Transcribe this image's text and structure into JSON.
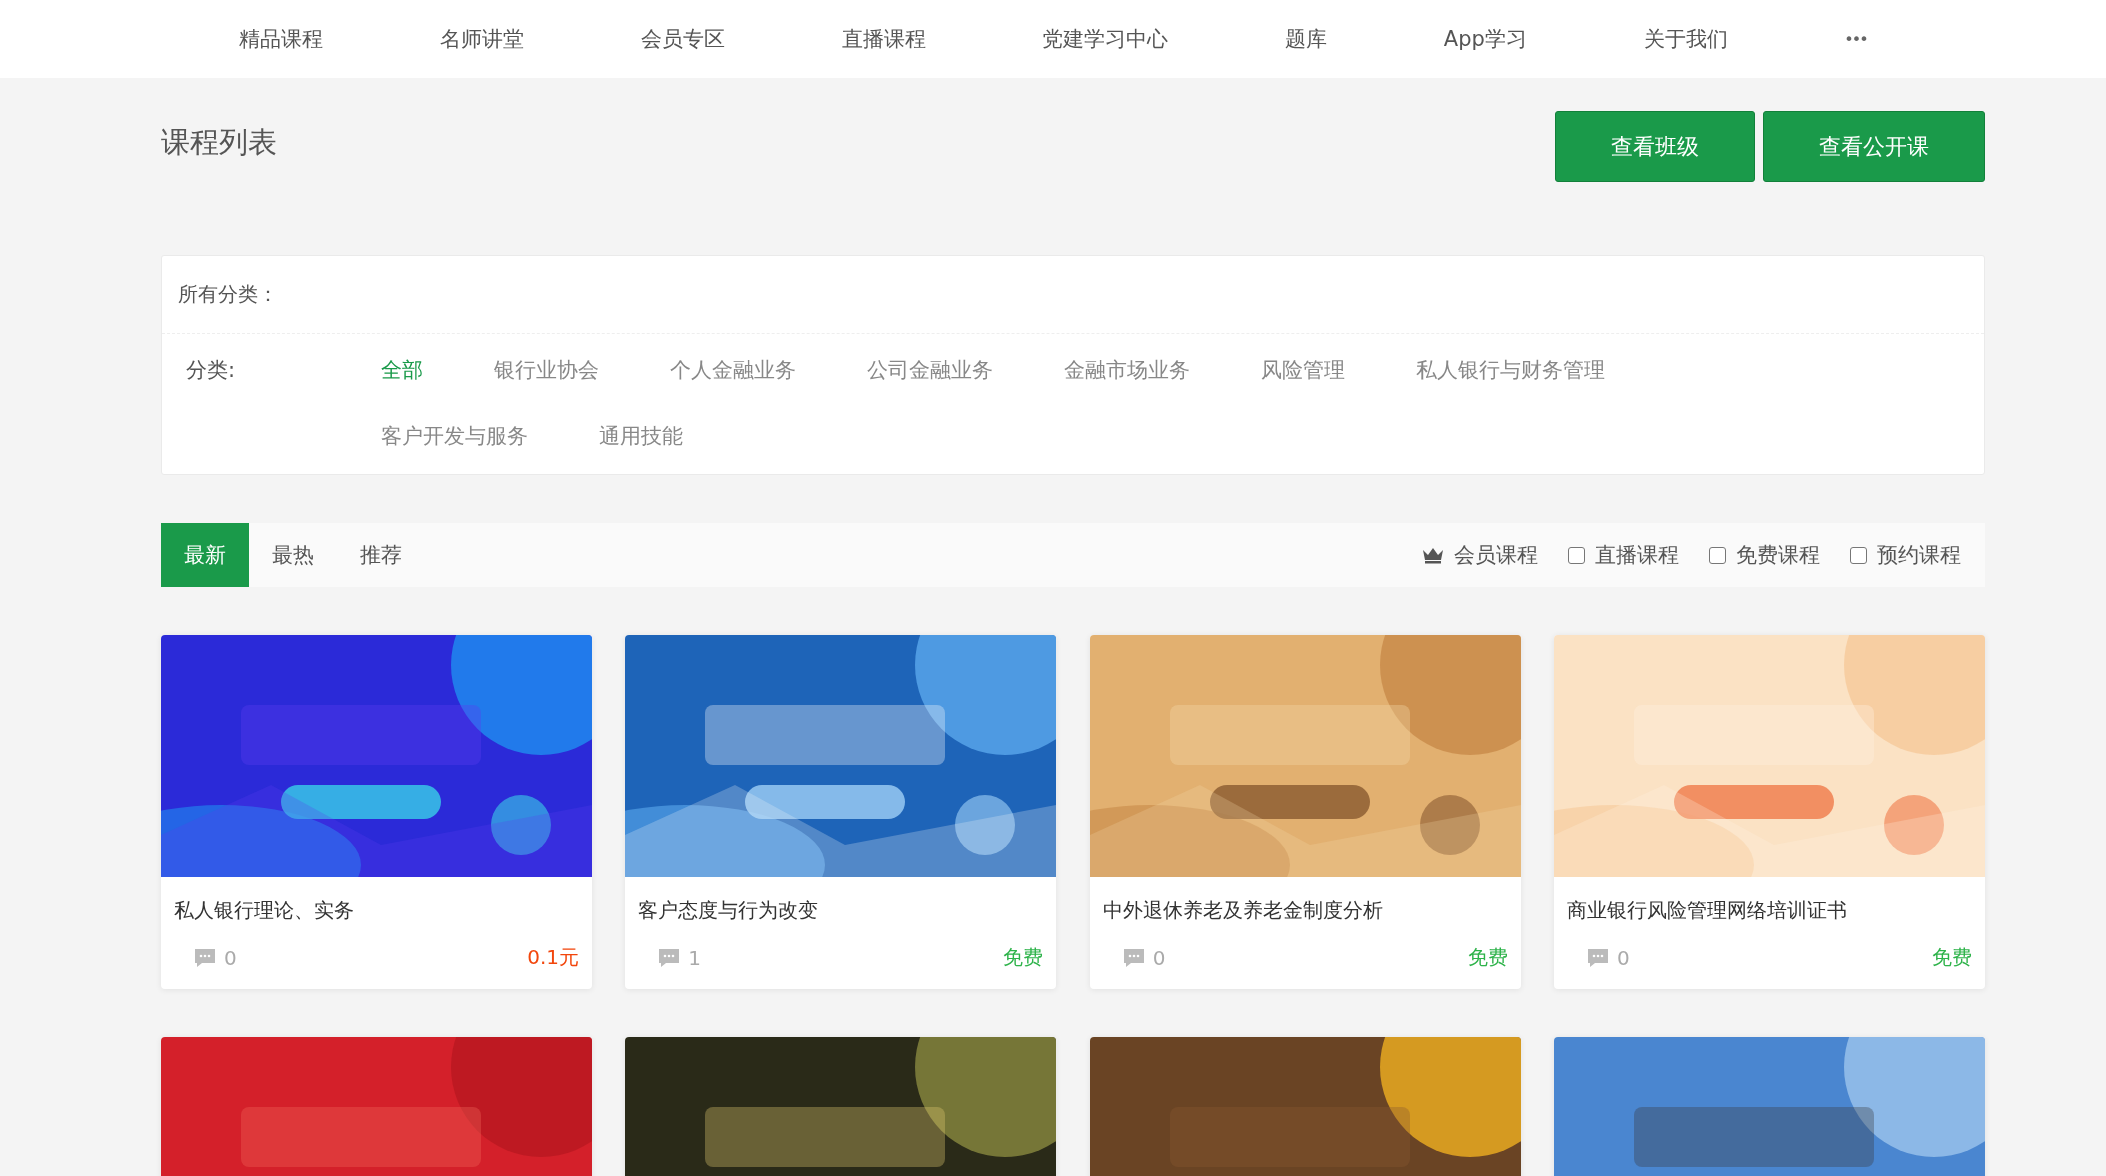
{
  "nav": {
    "items": [
      {
        "label": "精品课程"
      },
      {
        "label": "名师讲堂"
      },
      {
        "label": "会员专区"
      },
      {
        "label": "直播课程"
      },
      {
        "label": "党建学习中心"
      },
      {
        "label": "题库"
      },
      {
        "label": "App学习"
      },
      {
        "label": "关于我们"
      }
    ],
    "more": "•••"
  },
  "header": {
    "title": "课程列表",
    "buttons": [
      "查看班级",
      "查看公开课"
    ]
  },
  "filter": {
    "heading": "所有分类：",
    "label": "分类:",
    "categories": [
      {
        "label": "全部",
        "selected": true
      },
      {
        "label": "银行业协会",
        "selected": false
      },
      {
        "label": "个人金融业务",
        "selected": false
      },
      {
        "label": "公司金融业务",
        "selected": false
      },
      {
        "label": "金融市场业务",
        "selected": false
      },
      {
        "label": "风险管理",
        "selected": false
      },
      {
        "label": "私人银行与财务管理",
        "selected": false
      },
      {
        "label": "客户开发与服务",
        "selected": false
      },
      {
        "label": "通用技能",
        "selected": false
      }
    ]
  },
  "sort_tabs": [
    {
      "label": "最新",
      "selected": true
    },
    {
      "label": "最热",
      "selected": false
    },
    {
      "label": "推荐",
      "selected": false
    }
  ],
  "options": [
    {
      "kind": "crown",
      "label": "会员课程"
    },
    {
      "kind": "checkbox",
      "label": "直播课程",
      "checked": false
    },
    {
      "kind": "checkbox",
      "label": "免费课程",
      "checked": false
    },
    {
      "kind": "checkbox",
      "label": "预约课程",
      "checked": false
    }
  ],
  "cards": [
    {
      "cover": {
        "kind": "picture"
      },
      "title": "私人银行理论、实务",
      "comments": "0",
      "price": "0.1元",
      "kind": "paid"
    },
    {
      "cover": {
        "kind": "picture"
      },
      "title": "客户态度与行为改变",
      "comments": "1",
      "price": "免费",
      "kind": "free"
    },
    {
      "cover": {
        "kind": "picture"
      },
      "title": "中外退休养老及养老金制度分析",
      "comments": "0",
      "price": "免费",
      "kind": "free"
    },
    {
      "cover": {
        "kind": "picture"
      },
      "title": "商业银行风险管理网络培训证书",
      "comments": "0",
      "price": "免费",
      "kind": "free"
    },
    {
      "cover": {
        "kind": "picture"
      }
    },
    {
      "cover": {
        "kind": "picture"
      }
    },
    {
      "cover": {
        "kind": "picture"
      }
    },
    {
      "cover": {
        "kind": "picture"
      }
    }
  ]
}
